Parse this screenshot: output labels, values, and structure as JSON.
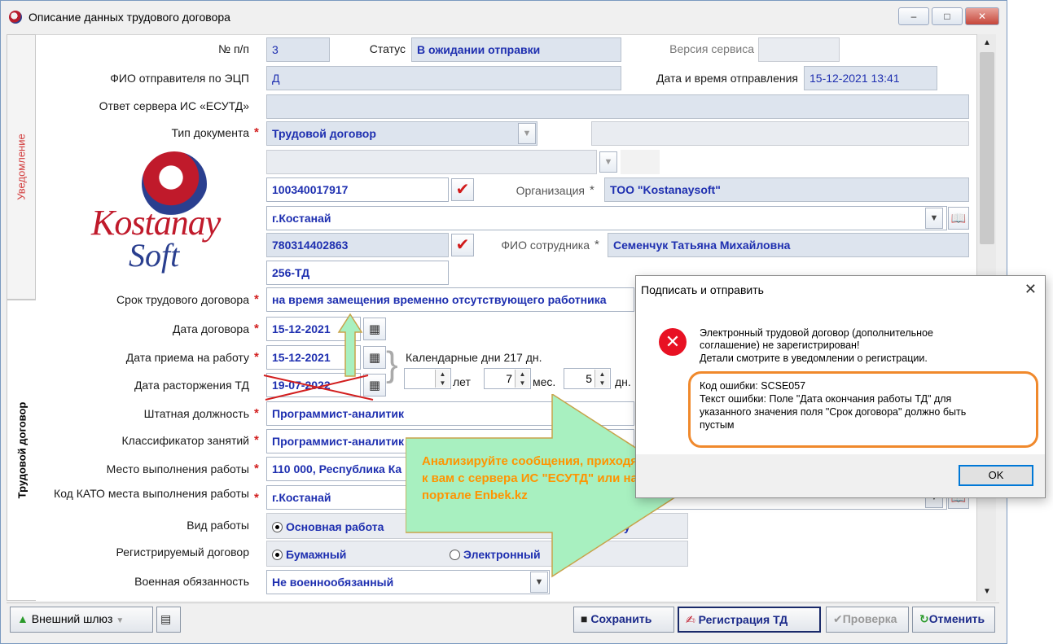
{
  "window": {
    "title": "Описание данных трудового договора",
    "minimize": "–",
    "maximize": "□",
    "close": "✕"
  },
  "tabs": {
    "notification": "Уведомление",
    "contract": "Трудовой договор"
  },
  "form": {
    "num_label": "№ п/п",
    "num_value": "3",
    "status_label": "Статус",
    "status_value": "В ожидании отправки",
    "service_version_label": "Версия сервиса",
    "service_version_value": "",
    "sender_label": "ФИО отправителя по ЭЦП",
    "sender_value": "Д",
    "sent_datetime_label": "Дата и время отправления",
    "sent_datetime_value": "15-12-2021 13:41",
    "server_response_label": "Ответ сервера ИС «ЕСУТД»",
    "server_response_value": "",
    "doc_type_label": "Тип документа",
    "doc_type_value": "Трудовой договор",
    "bin_value": "100340017917",
    "org_label": "Организация",
    "org_value": "ТОО \"Kostanaysoft\"",
    "city_value": "г.Костанай",
    "iin_value": "780314402863",
    "employee_label": "ФИО сотрудника",
    "employee_value": "Семенчук Татьяна Михайловна",
    "contract_no_value": "256-ТД",
    "term_label": "Срок трудового договора",
    "term_value": "на время замещения временно отсутствующего работника",
    "contract_date_label": "Дата договора",
    "contract_date_value": "15-12-2021",
    "hire_date_label": "Дата приема на работу",
    "hire_date_value": "15-12-2021",
    "calendar_days_label": "Календарные дни 217 дн.",
    "term_date_label": "Дата расторжения ТД",
    "term_date_value": "19-07-2022",
    "years_value": "",
    "years_unit": "лет",
    "months_value": "7",
    "months_unit": "мес.",
    "days_value": "5",
    "days_unit": "дн.",
    "position_label": "Штатная должность",
    "position_value": "Программист-аналитик",
    "classifier_label": "Классификатор занятий",
    "classifier_value": "Программист-аналитик",
    "workplace_label": "Место выполнения работы",
    "workplace_value": "110 000, Республика Ка",
    "kato_label": "Код КАТО места выполнения работы",
    "kato_value": "г.Костанай",
    "work_type_label": "Вид работы",
    "work_type_main": "Основная работа",
    "work_type_other": "у",
    "reg_contract_label": "Регистрируемый договор",
    "reg_paper": "Бумажный",
    "reg_electronic": "Электронный",
    "military_label": "Военная обязанность",
    "military_value": "Не военнообязанный"
  },
  "logo": {
    "line1": "Kostanay",
    "line2": "Soft"
  },
  "toolbar": {
    "gateway_label": "Внешний шлюз",
    "save_label": "Сохранить",
    "register_label": "Регистрация ТД",
    "check_label": "Проверка",
    "cancel_label": "Отменить"
  },
  "dialog": {
    "title": "Подписать и отправить",
    "line1": "Электронный трудовой договор (дополнительное",
    "line2": "соглашение) не зарегистрирован!",
    "line3": "Детали смотрите в уведомлении о регистрации.",
    "err_code": "Код ошибки: SCSE057",
    "err_text1": "Текст ошибки: Поле \"Дата окончания работы ТД\" для",
    "err_text2": "указанного значения поля \"Срок договора\" должно быть",
    "err_text3": "пустым",
    "ok_label": "OK"
  },
  "annotation": {
    "text": "Анализируйте сообщения, приходящие к вам с сервера ИС \"ЕСУТД\" или на портале Enbek.kz"
  },
  "colors": {
    "field_text": "#1e2fb0",
    "required": "#d21e1e",
    "annotation_arrow": "#a8f0c0",
    "annotation_text": "#ff9400",
    "error_box": "#f0892c"
  }
}
